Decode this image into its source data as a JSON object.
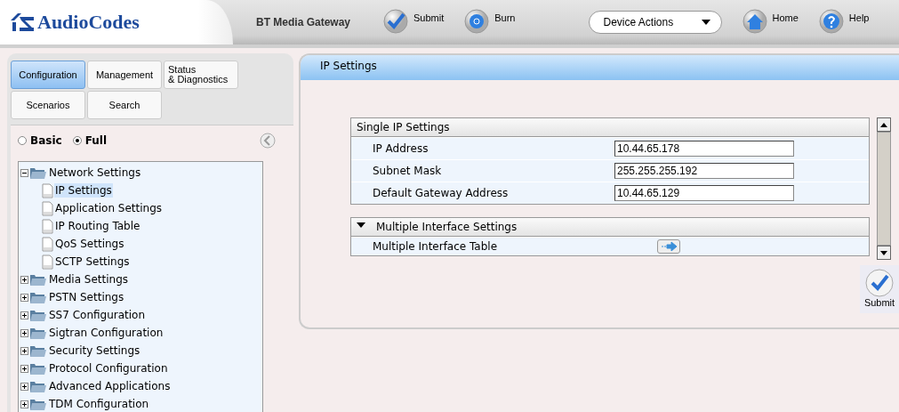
{
  "header": {
    "logo": "AudioCodes",
    "product": "BT Media Gateway",
    "actions": [
      {
        "kind": "submit",
        "label": "Submit"
      },
      {
        "kind": "burn",
        "label": "Burn"
      },
      {
        "kind": "dropdown",
        "label": "Device Actions"
      },
      {
        "kind": "home",
        "label": "Home"
      },
      {
        "kind": "help",
        "label": "Help"
      }
    ]
  },
  "tabs": [
    {
      "label": "Configuration",
      "selected": true
    },
    {
      "label": "Management",
      "selected": false
    },
    {
      "label": "Status\n& Diagnostics",
      "selected": false
    },
    {
      "label": "Scenarios",
      "selected": false
    },
    {
      "label": "Search",
      "selected": false
    }
  ],
  "view_mode": [
    {
      "label": "Basic",
      "selected": false
    },
    {
      "label": "Full",
      "selected": true
    }
  ],
  "tree": [
    {
      "label": "Network Settings",
      "expanded": true,
      "children": [
        {
          "label": "IP Settings",
          "selected": true
        },
        {
          "label": "Application Settings",
          "selected": false
        },
        {
          "label": "IP Routing Table",
          "selected": false
        },
        {
          "label": "QoS Settings",
          "selected": false
        },
        {
          "label": "SCTP Settings",
          "selected": false
        }
      ]
    },
    {
      "label": "Media Settings",
      "expanded": false
    },
    {
      "label": "PSTN Settings",
      "expanded": false
    },
    {
      "label": "SS7 Configuration",
      "expanded": false
    },
    {
      "label": "Sigtran Configuration",
      "expanded": false
    },
    {
      "label": "Security Settings",
      "expanded": false
    },
    {
      "label": "Protocol Configuration",
      "expanded": false
    },
    {
      "label": "Advanced Applications",
      "expanded": false
    },
    {
      "label": "TDM Configuration",
      "expanded": false
    }
  ],
  "page": {
    "title": "IP Settings",
    "sections": [
      {
        "title": "Single IP Settings",
        "fields": [
          {
            "label": "IP Address",
            "value": "10.44.65.178"
          },
          {
            "label": "Subnet Mask",
            "value": "255.255.255.192"
          },
          {
            "label": "Default Gateway Address",
            "value": "10.44.65.129"
          }
        ]
      },
      {
        "title": "Multiple Interface Settings",
        "expanded": true,
        "links": [
          {
            "label": "Multiple Interface Table"
          }
        ]
      }
    ],
    "submit": "Submit"
  }
}
